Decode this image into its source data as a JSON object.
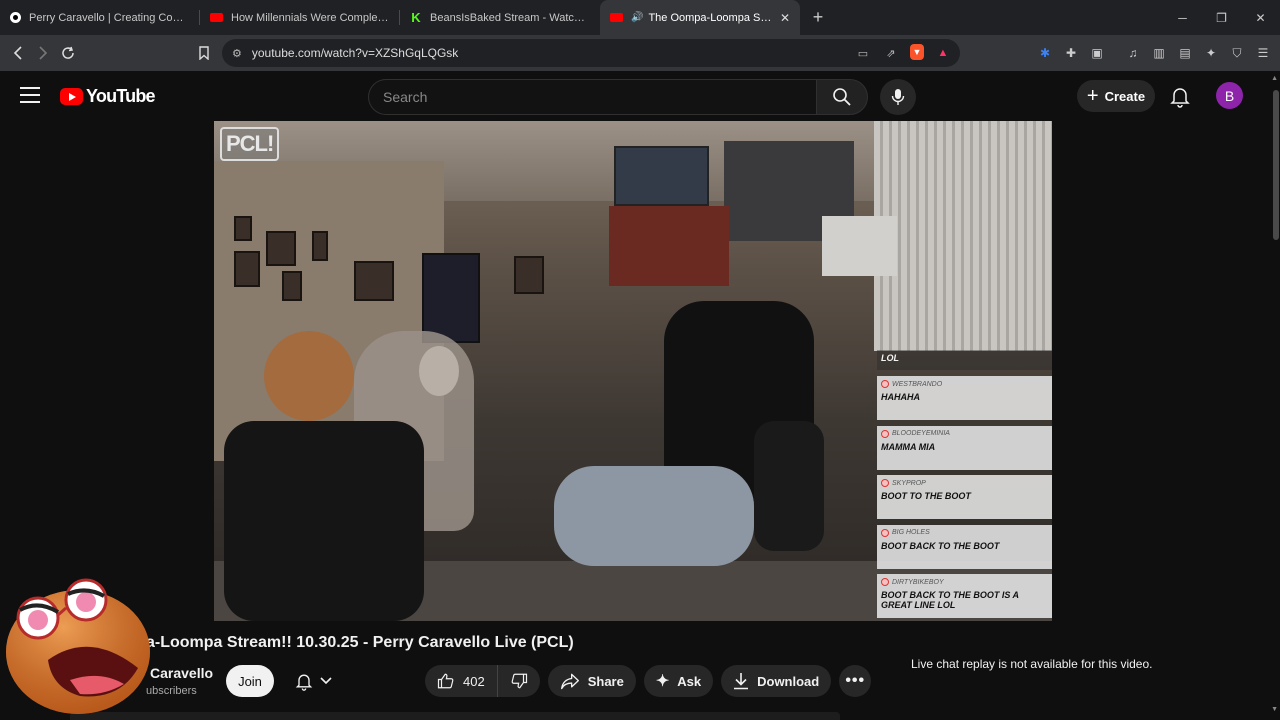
{
  "browser": {
    "tabs": [
      {
        "title": "Perry Caravello | Creating Comedy, V",
        "icon": "patreon-icon",
        "active": false
      },
      {
        "title": "How Millennials Were Completely Br",
        "icon": "youtube-icon",
        "active": false
      },
      {
        "title": "BeansIsBaked Stream - Watch Live on",
        "icon": "kick-icon",
        "active": false
      },
      {
        "title": "The Oompa-Loompa Stream!!",
        "icon": "youtube-icon",
        "active": true
      }
    ],
    "url": "youtube.com/watch?v=XZShGqLQGsk"
  },
  "youtube": {
    "logo_text": "YouTube",
    "search_placeholder": "Search",
    "create_label": "Create",
    "avatar_letter": "B"
  },
  "video": {
    "watermark": "PCL!",
    "overlay_chat": [
      {
        "user": "",
        "message": "LOL"
      },
      {
        "user": "WESTBRANDO",
        "message": "HAHAHA"
      },
      {
        "user": "BLOODEYEMINIA",
        "message": "MAMMA MIA"
      },
      {
        "user": "SKYPROP",
        "message": "BOOT TO THE BOOT"
      },
      {
        "user": "BIG HOLES",
        "message": "BOOT BACK TO THE BOOT"
      },
      {
        "user": "DIRTYBIKEBOY",
        "message": "BOOT BACK TO THE BOOT IS A GREAT LINE LOL"
      }
    ]
  },
  "details": {
    "title": "a-Loompa Stream!! 10.30.25 - Perry Caravello Live (PCL)",
    "channel": "Caravello",
    "subscribers": "ubscribers",
    "join_label": "Join",
    "likes": "402",
    "share_label": "Share",
    "ask_label": "Ask",
    "download_label": "Download",
    "chat_replay_notice": "Live chat replay is not available for this video."
  },
  "colors": {
    "yt_red": "#ff0000",
    "avatar_purple": "#8e24aa",
    "background": "#0f0f0f"
  }
}
